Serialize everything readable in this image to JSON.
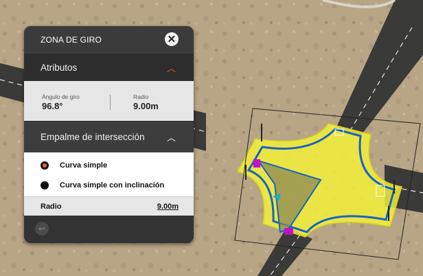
{
  "panel": {
    "title": "ZONA DE GIRO",
    "close_icon": "close-icon",
    "attributes": {
      "label": "Atributos",
      "turn_angle_label": "Ángulo de giro",
      "turn_angle_value": "96.8°",
      "radius_label": "Radio",
      "radius_value": "9.00m"
    },
    "junction": {
      "label": "Empalme de intersección",
      "options": [
        "Curva simple",
        "Curva simple con inclinación"
      ],
      "selected_option": "Curva simple",
      "radius_label": "Radio",
      "radius_value": "9.00m"
    },
    "footer_icon": "undo-icon"
  },
  "colors": {
    "accent": "#f26522",
    "selection_fill": "#f2ee3a",
    "outline": "#1565c0",
    "handle": "#c010c8"
  }
}
